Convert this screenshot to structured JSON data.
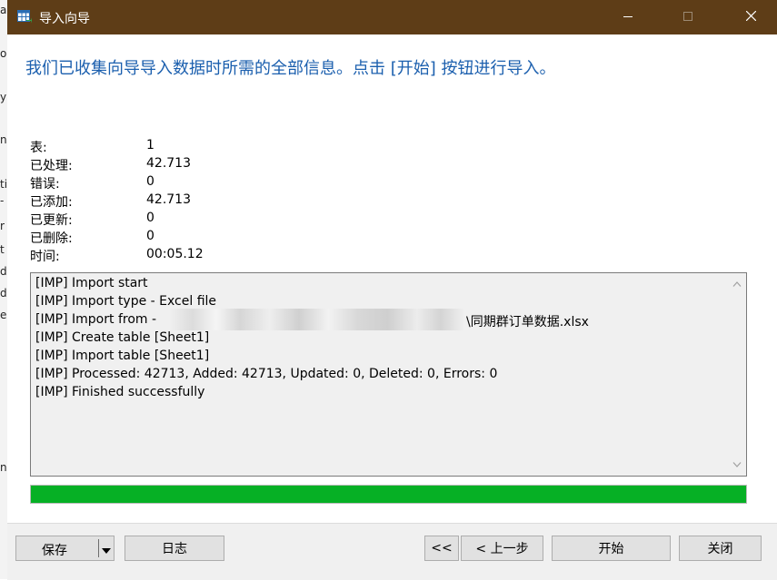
{
  "background_fragments": [
    "as",
    "o",
    "y",
    "n",
    "ti",
    "-",
    "r",
    "t",
    "d",
    "d",
    "e",
    "n"
  ],
  "window": {
    "title": "导入向导",
    "icon": "table-import-icon",
    "controls": [
      "minimize-icon",
      "maximize-icon",
      "close-icon"
    ]
  },
  "heading": "我们已收集向导导入数据时所需的全部信息。点击 [开始] 按钮进行导入。",
  "stats": [
    {
      "label": "表:",
      "value": "1"
    },
    {
      "label": "已处理:",
      "value": "42.713"
    },
    {
      "label": "错误:",
      "value": "0"
    },
    {
      "label": "已添加:",
      "value": "42.713"
    },
    {
      "label": "已更新:",
      "value": "0"
    },
    {
      "label": "已删除:",
      "value": "0"
    },
    {
      "label": "时间:",
      "value": "00:05.12"
    }
  ],
  "log": [
    "[IMP] Import start",
    "[IMP] Import type - Excel file",
    "[IMP] Import from -",
    "[IMP] Create table [Sheet1]",
    "[IMP] Import table [Sheet1]",
    "[IMP] Processed: 42713, Added: 42713, Updated: 0, Deleted: 0, Errors: 0",
    "[IMP] Finished successfully"
  ],
  "log_import_from_suffix": "\\同期群订单数据.xlsx",
  "progress": {
    "percent": 100,
    "color": "#06b025"
  },
  "footer": {
    "save": "保存",
    "log": "日志",
    "first": "<<",
    "prev": "< 上一步",
    "start": "开始",
    "close": "关闭"
  },
  "colors": {
    "titlebar": "#5e3d17",
    "heading": "#1b5fae"
  }
}
